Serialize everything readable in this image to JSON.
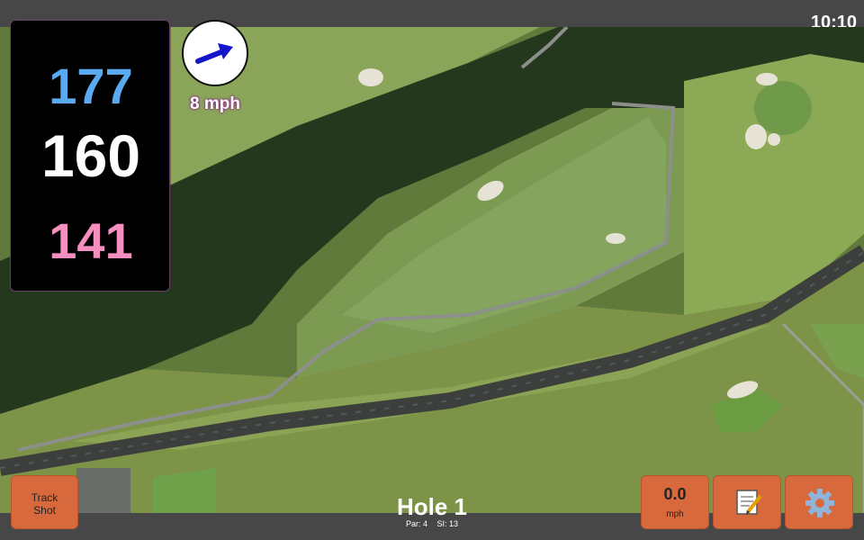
{
  "status": {
    "time": "10:10"
  },
  "distances": {
    "back": "177",
    "middle": "160",
    "front": "141"
  },
  "wind": {
    "speed_label": "8 mph",
    "icon": "wind-direction-arrow-icon"
  },
  "buttons": {
    "track_shot": {
      "line1": "Track",
      "line2": "Shot"
    },
    "wind_readout": {
      "value": "0.0",
      "unit": "mph"
    },
    "notes": {
      "icon": "notepad-icon"
    },
    "settings": {
      "icon": "gear-icon"
    }
  },
  "hole": {
    "title": "Hole 1",
    "par": "Par: 4",
    "si": "SI: 13"
  },
  "colors": {
    "back": "#5aaaf2",
    "middle": "#ffffff",
    "front": "#f58fbf",
    "button": "#d8693c"
  }
}
